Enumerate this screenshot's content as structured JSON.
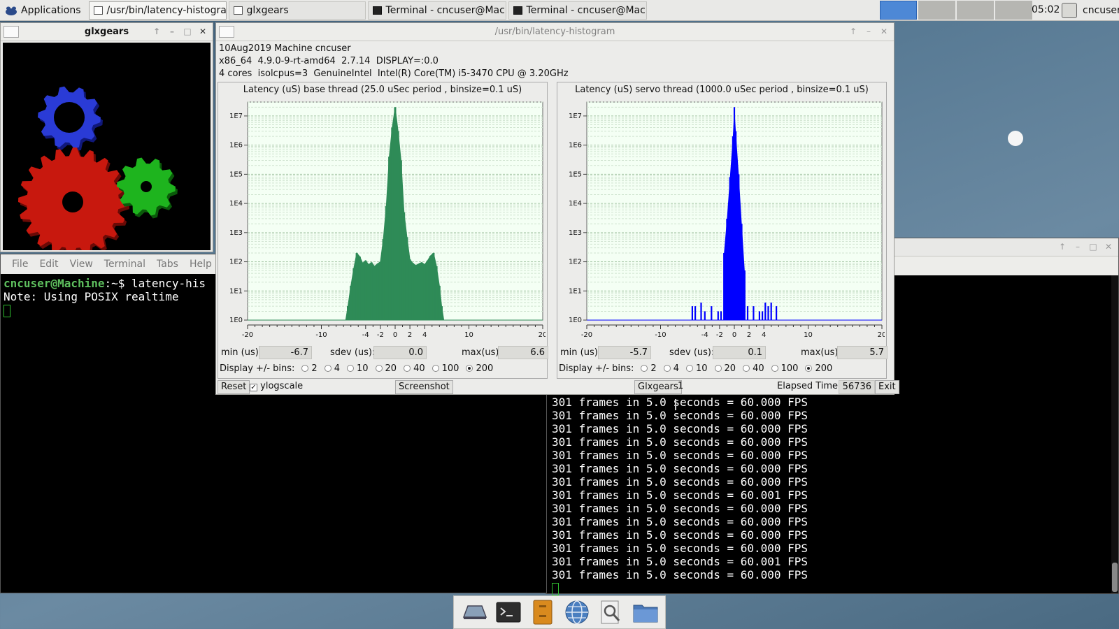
{
  "top_panel": {
    "applications_label": "Applications",
    "tasks": [
      {
        "label": "/usr/bin/latency-histogram",
        "icon": "window-icon",
        "active": true
      },
      {
        "label": "glxgears",
        "icon": "window-icon",
        "active": false
      },
      {
        "label": "Terminal - cncuser@Mac...",
        "icon": "terminal-icon",
        "active": false
      },
      {
        "label": "Terminal - cncuser@Mac...",
        "icon": "terminal-icon",
        "active": false
      }
    ],
    "clock": "05:02",
    "user": "cncuser"
  },
  "glxgears_window": {
    "title": "glxgears"
  },
  "latency_window": {
    "title": "/usr/bin/latency-histogram",
    "info_line1": "10Aug2019 Machine cncuser",
    "info_line2": "x86_64  4.9.0-9-rt-amd64  2.7.14  DISPLAY=:0.0",
    "info_line3": "4 cores  isolcpus=3  GenuineIntel  Intel(R) Core(TM) i5-3470 CPU @ 3.20GHz",
    "base": {
      "title": "Latency (uS) base thread (25.0 uSec period , binsize=0.1 uS)",
      "min_label": "min (us)",
      "min_value": "-6.7",
      "sdev_label": "sdev (us):",
      "sdev_value": "0.0",
      "max_label": "max(us)",
      "max_value": "6.6",
      "bins_label": "Display +/- bins:"
    },
    "servo": {
      "title": "Latency (uS) servo thread (1000.0 uSec period , binsize=0.1 uS)",
      "min_label": "min (us)",
      "min_value": "-5.7",
      "sdev_label": "sdev (us):",
      "sdev_value": "0.1",
      "max_label": "max(us)",
      "max_value": "5.7",
      "bins_label": "Display +/- bins:"
    },
    "bin_options": [
      "2",
      "4",
      "10",
      "20",
      "40",
      "100",
      "200"
    ],
    "bin_selected": "200",
    "reset_label": "Reset",
    "ylogscale_label": "ylogscale",
    "ylogscale_checked": true,
    "screenshot_label": "Screenshot",
    "glxgears_label": "Glxgears",
    "glxgears_value": "1",
    "elapsed_label": "Elapsed Time:",
    "elapsed_value": "56736",
    "exit_label": "Exit"
  },
  "chart_data": [
    {
      "type": "bar",
      "title": "Latency (uS) base thread (25.0 uSec period , binsize=0.1 uS)",
      "xlabel": "",
      "ylabel": "",
      "xlim": [
        -20,
        20
      ],
      "x_ticks": [
        "-20",
        "-10",
        "-4",
        "-2",
        "0",
        "2",
        "4",
        "10",
        "20"
      ],
      "y_scale": "log",
      "y_ticks": [
        "1E0",
        "1E1",
        "1E2",
        "1E3",
        "1E4",
        "1E5",
        "1E6",
        "1E7"
      ],
      "ylim": [
        1,
        30000000
      ],
      "grid": true,
      "color": "#2e8b57",
      "x": [
        -6.7,
        -6.4,
        -6.0,
        -5.6,
        -5.2,
        -4.8,
        -4.4,
        -4.0,
        -3.6,
        -3.2,
        -2.8,
        -2.4,
        -2.0,
        -1.6,
        -1.2,
        -0.8,
        -0.4,
        0.0,
        0.4,
        0.8,
        1.2,
        1.6,
        2.0,
        2.4,
        2.8,
        3.2,
        3.6,
        4.0,
        4.4,
        4.8,
        5.2,
        5.6,
        6.0,
        6.3,
        6.6
      ],
      "values": [
        1,
        3,
        15,
        60,
        200,
        150,
        90,
        110,
        80,
        95,
        70,
        85,
        100,
        600,
        8000,
        400000,
        4000000,
        20000000,
        3000000,
        300000,
        5000,
        700,
        120,
        90,
        75,
        85,
        95,
        80,
        110,
        160,
        200,
        70,
        15,
        3,
        1
      ]
    },
    {
      "type": "bar",
      "title": "Latency (uS) servo thread (1000.0 uSec period , binsize=0.1 uS)",
      "xlabel": "",
      "ylabel": "",
      "xlim": [
        -20,
        20
      ],
      "x_ticks": [
        "-20",
        "-10",
        "-4",
        "-2",
        "0",
        "2",
        "4",
        "10",
        "20"
      ],
      "y_scale": "log",
      "y_ticks": [
        "1E0",
        "1E1",
        "1E2",
        "1E3",
        "1E4",
        "1E5",
        "1E6",
        "1E7"
      ],
      "ylim": [
        1,
        30000000
      ],
      "grid": true,
      "color": "#0000ff",
      "x": [
        -5.7,
        -5.3,
        -4.9,
        -4.5,
        -4.0,
        -3.6,
        -3.1,
        -2.7,
        -2.2,
        -1.8,
        -1.4,
        -1.0,
        -0.6,
        -0.2,
        0.0,
        0.2,
        0.6,
        1.0,
        1.4,
        1.8,
        2.2,
        2.6,
        3.0,
        3.4,
        3.8,
        4.2,
        4.6,
        5.0,
        5.4,
        5.7
      ],
      "values": [
        3,
        3,
        1,
        4,
        2,
        1,
        3,
        1,
        2,
        2,
        200,
        3000,
        80000,
        2000000,
        20000000,
        3000000,
        100000,
        2000,
        50,
        3,
        1,
        3,
        1,
        2,
        2,
        4,
        3,
        4,
        1,
        3
      ]
    }
  ],
  "left_terminal": {
    "menu": [
      "File",
      "Edit",
      "View",
      "Terminal",
      "Tabs",
      "Help"
    ],
    "prompt": "cncuser@Machine",
    "prompt_path": ":~$ ",
    "command": "latency-his",
    "output_line": "Note: Using POSIX realtime"
  },
  "right_terminal": {
    "lines": [
      "301 frames in 5.0 seconds = 60.000 FPS",
      "301 frames in 5.0 seconds = 60.000 FPS",
      "301 frames in 5.0 seconds = 60.000 FPS",
      "301 frames in 5.0 seconds = 60.000 FPS",
      "301 frames in 5.0 seconds = 60.000 FPS",
      "301 frames in 5.0 seconds = 60.000 FPS",
      "301 frames in 5.0 seconds = 60.000 FPS",
      "301 frames in 5.0 seconds = 60.001 FPS",
      "301 frames in 5.0 seconds = 60.000 FPS",
      "301 frames in 5.0 seconds = 60.000 FPS",
      "301 frames in 5.0 seconds = 60.000 FPS",
      "301 frames in 5.0 seconds = 60.000 FPS",
      "301 frames in 5.0 seconds = 60.001 FPS",
      "301 frames in 5.0 seconds = 60.000 FPS"
    ]
  },
  "dock": {
    "items": [
      "show-desktop-icon",
      "terminal-icon",
      "file-manager-icon",
      "web-browser-icon",
      "app-finder-icon",
      "folder-icon"
    ]
  }
}
